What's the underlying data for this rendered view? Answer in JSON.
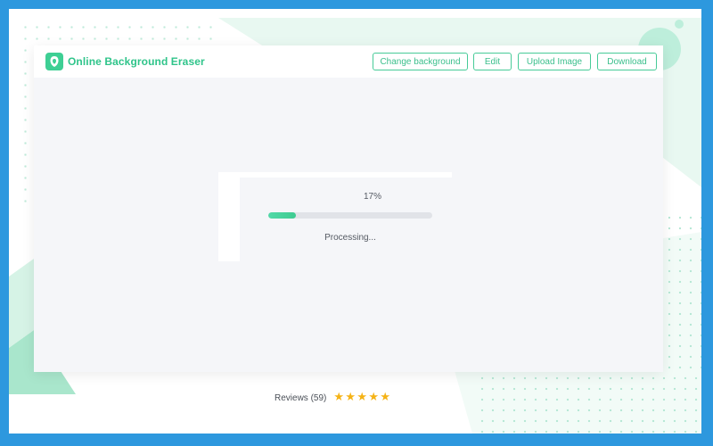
{
  "app": {
    "title": "Online Background Eraser",
    "logo_icon": "shield-leaf-icon"
  },
  "header": {
    "buttons": [
      {
        "label": "Change background"
      },
      {
        "label": "Edit"
      },
      {
        "label": "Upload Image"
      },
      {
        "label": "Download"
      }
    ]
  },
  "progress": {
    "percent_label": "17%",
    "value": 0.17,
    "status": "Processing..."
  },
  "reviews": {
    "label": "Reviews (59)",
    "rating": 5,
    "star_icon": "star-icon"
  },
  "colors": {
    "accent": "#3ecf94",
    "frame": "#2d98de",
    "star": "#f5b316",
    "canvas": "#f5f6f9"
  }
}
